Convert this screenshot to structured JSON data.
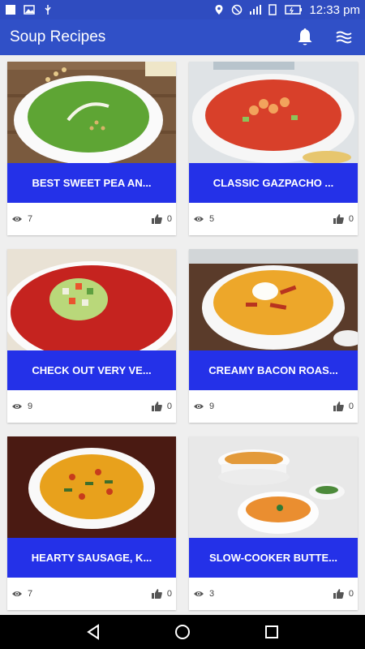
{
  "status": {
    "time": "12:33 pm"
  },
  "app": {
    "title": "Soup Recipes"
  },
  "colors": {
    "status_bar": "#2f4cc0",
    "app_bar": "#3050c7",
    "title_band": "#2431e8"
  },
  "recipes": [
    {
      "title": "BEST SWEET PEA AN...",
      "views": "7",
      "likes": "0"
    },
    {
      "title": "CLASSIC GAZPACHO ...",
      "views": "5",
      "likes": "0"
    },
    {
      "title": "CHECK OUT VERY VE...",
      "views": "9",
      "likes": "0"
    },
    {
      "title": "CREAMY BACON ROAS...",
      "views": "9",
      "likes": "0"
    },
    {
      "title": "HEARTY SAUSAGE, K...",
      "views": "7",
      "likes": "0"
    },
    {
      "title": "SLOW-COOKER BUTTE...",
      "views": "3",
      "likes": "0"
    }
  ]
}
